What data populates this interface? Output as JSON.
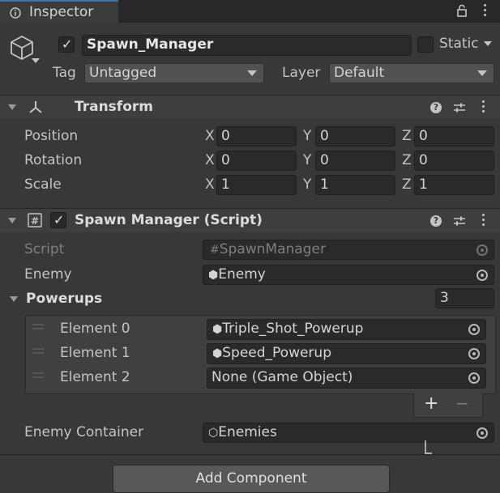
{
  "tab": {
    "title": "Inspector",
    "icon": "info-icon"
  },
  "object": {
    "active": true,
    "name": "Spawn_Manager",
    "static_label": "Static",
    "static_checked": false,
    "tag_label": "Tag",
    "tag_value": "Untagged",
    "layer_label": "Layer",
    "layer_value": "Default"
  },
  "transform": {
    "title": "Transform",
    "rows": [
      {
        "label": "Position",
        "x": "0",
        "y": "0",
        "z": "0"
      },
      {
        "label": "Rotation",
        "x": "0",
        "y": "0",
        "z": "0"
      },
      {
        "label": "Scale",
        "x": "1",
        "y": "1",
        "z": "1"
      }
    ],
    "axes": {
      "x": "X",
      "y": "Y",
      "z": "Z"
    }
  },
  "spawn_manager": {
    "title": "Spawn Manager (Script)",
    "enabled": true,
    "script_label": "Script",
    "script_value": "SpawnManager",
    "enemy_label": "Enemy",
    "enemy_value": "Enemy",
    "powerups_label": "Powerups",
    "powerups_count": "3",
    "elements": [
      {
        "label": "Element 0",
        "value": "Triple_Shot_Powerup",
        "icon": "prefab-icon"
      },
      {
        "label": "Element 1",
        "value": "Speed_Powerup",
        "icon": "prefab-icon"
      },
      {
        "label": "Element 2",
        "value": "None (Game Object)",
        "icon": ""
      }
    ],
    "plus": "+",
    "minus": "−",
    "container_label": "Enemy Container",
    "container_value": "Enemies"
  },
  "add_component": "Add Component"
}
